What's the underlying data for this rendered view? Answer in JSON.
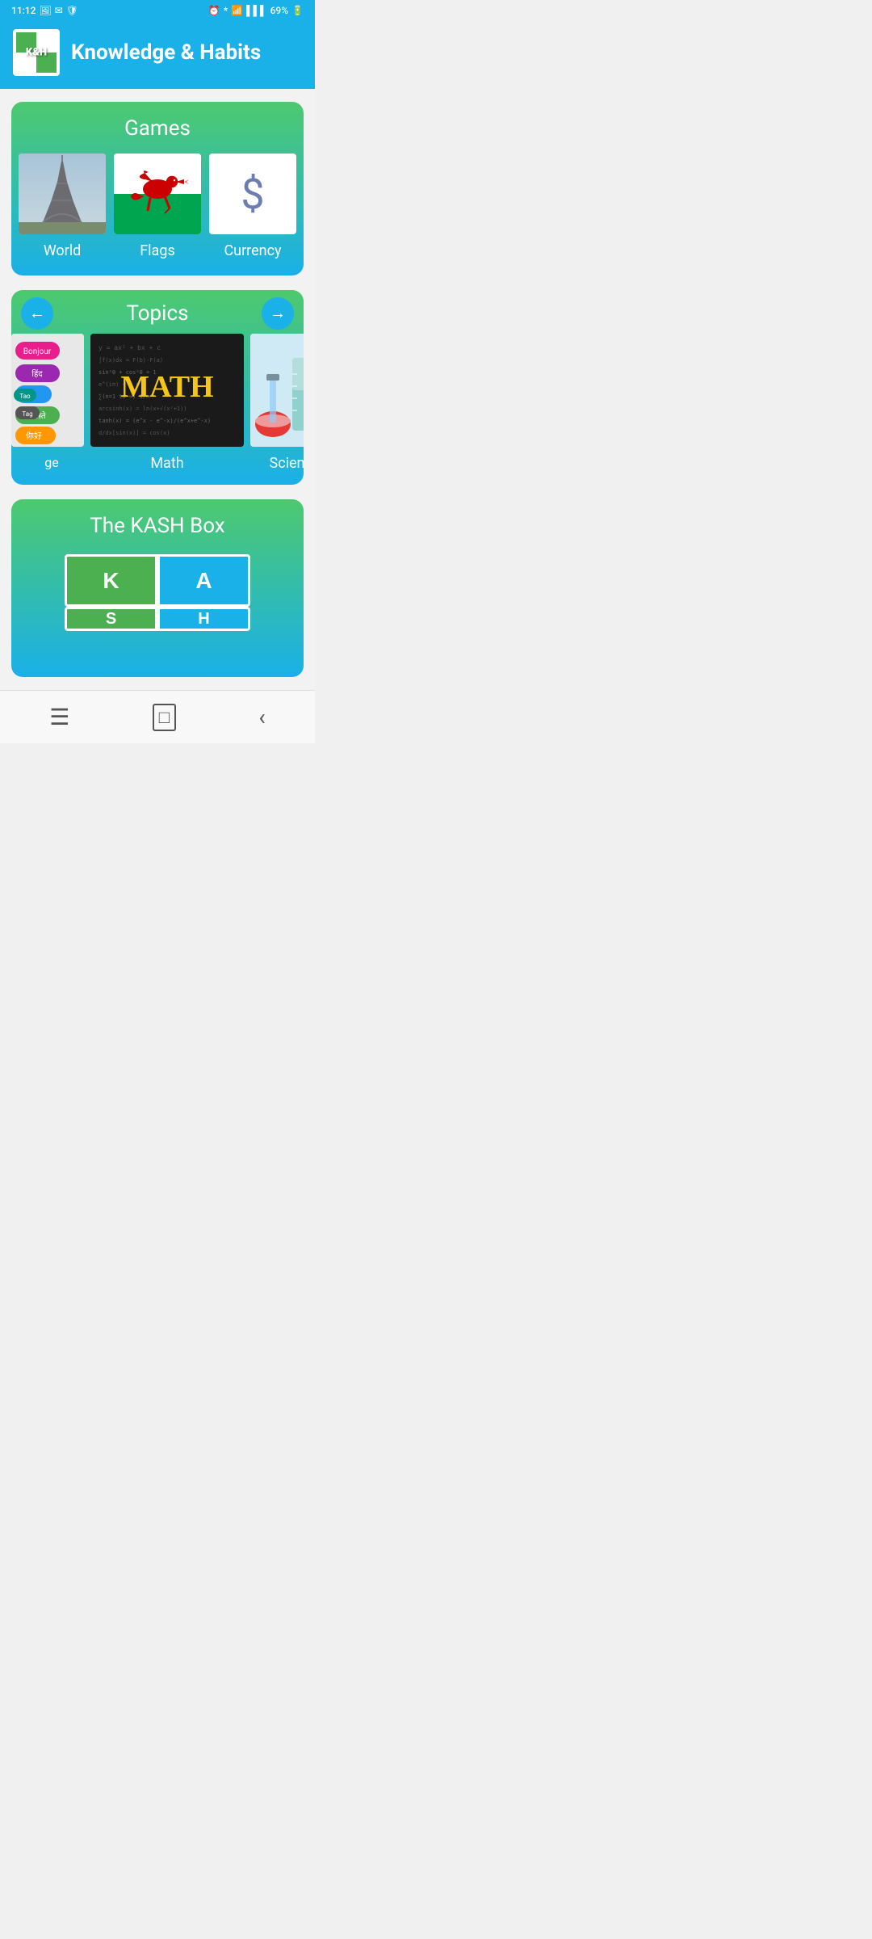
{
  "statusBar": {
    "time": "11:12",
    "battery": "69%"
  },
  "header": {
    "title": "Knowledge & Habits",
    "logoText": "K&H"
  },
  "gamesSection": {
    "title": "Games",
    "items": [
      {
        "id": "world",
        "label": "World"
      },
      {
        "id": "flags",
        "label": "Flags"
      },
      {
        "id": "currency",
        "label": "Currency"
      }
    ]
  },
  "topicsSection": {
    "title": "Topics",
    "items": [
      {
        "id": "language",
        "label": "Language"
      },
      {
        "id": "math",
        "label": "Math"
      },
      {
        "id": "science",
        "label": "Science"
      }
    ]
  },
  "kashSection": {
    "title": "The KASH Box",
    "buttons": [
      {
        "id": "k",
        "label": "K"
      },
      {
        "id": "a",
        "label": "A"
      },
      {
        "id": "s",
        "label": "S"
      },
      {
        "id": "h",
        "label": "H"
      }
    ]
  },
  "bottomNav": {
    "items": [
      {
        "id": "menu",
        "icon": "≡",
        "label": "Menu"
      },
      {
        "id": "home",
        "icon": "□",
        "label": "Home"
      },
      {
        "id": "back",
        "icon": "‹",
        "label": "Back"
      }
    ]
  },
  "colors": {
    "headerBg": "#1ab0e8",
    "green": "#4dc96e",
    "blue": "#1ab0e8"
  }
}
